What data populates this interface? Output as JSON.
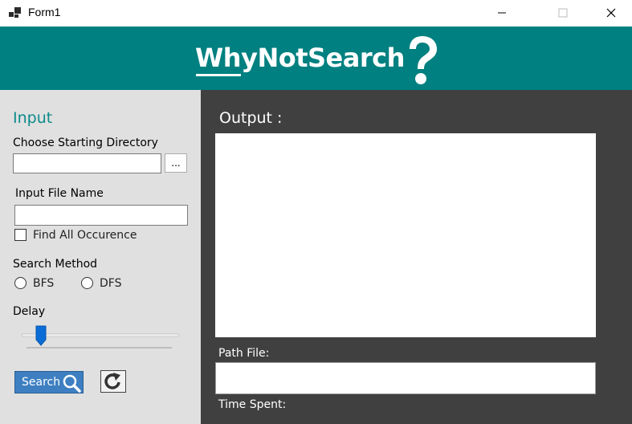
{
  "window": {
    "title": "Form1",
    "controls": [
      "minimize-icon",
      "maximize-icon",
      "close-icon"
    ]
  },
  "header": {
    "logo_text": "WhyNotSearch",
    "logo_icon": "question-mark-icon",
    "background": "#008080"
  },
  "input_panel": {
    "title": "Input",
    "directory_label": "Choose Starting Directory",
    "directory_value": "",
    "browse_label": "...",
    "file_name_label": "Input File Name",
    "file_name_value": "",
    "find_all_label": "Find All Occurence",
    "find_all_checked": false,
    "search_method_label": "Search Method",
    "methods": [
      {
        "label": "BFS",
        "selected": false
      },
      {
        "label": "DFS",
        "selected": false
      }
    ],
    "delay_label": "Delay",
    "delay_value": 0.1,
    "search_label": "Search",
    "search_icon": "magnifier-icon",
    "refresh_icon": "refresh-icon"
  },
  "output_panel": {
    "title": "Output :",
    "path_label": "Path File:",
    "path_value": "",
    "time_label": "Time Spent:"
  },
  "colors": {
    "accent": "#008080",
    "input_title": "#0e8a8a",
    "dark_panel": "#404040",
    "left_panel": "#e0e0e0",
    "search_button": "#3d7fc1"
  }
}
